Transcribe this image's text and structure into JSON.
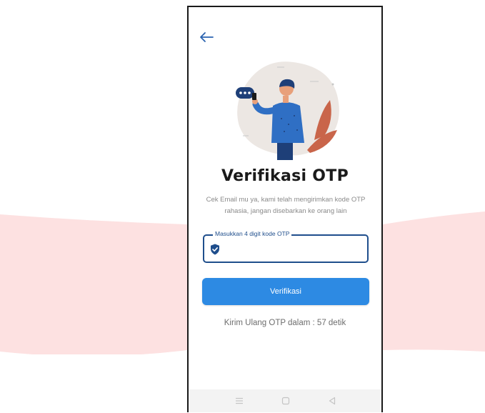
{
  "colors": {
    "band": "#fde1e1",
    "primary": "#2d8ae3",
    "field_border": "#1f4e8c",
    "title": "#1a1a1a",
    "muted": "#8a8a8a"
  },
  "header": {
    "back_icon": "arrow-left-icon"
  },
  "content": {
    "title": "Verifikasi OTP",
    "subtitle": "Cek Email mu ya, kami telah mengirimkan kode OTP rahasia, jangan disebarkan ke orang lain"
  },
  "otp": {
    "label": "Masukkan 4 digit kode OTP",
    "value": "",
    "icon": "shield-check-icon"
  },
  "actions": {
    "verify_label": "Verifikasi",
    "resend_text": "Kirim Ulang OTP dalam : 57 detik"
  },
  "navbar": {
    "items": [
      "menu-icon",
      "home-icon",
      "back-triangle-icon"
    ]
  }
}
